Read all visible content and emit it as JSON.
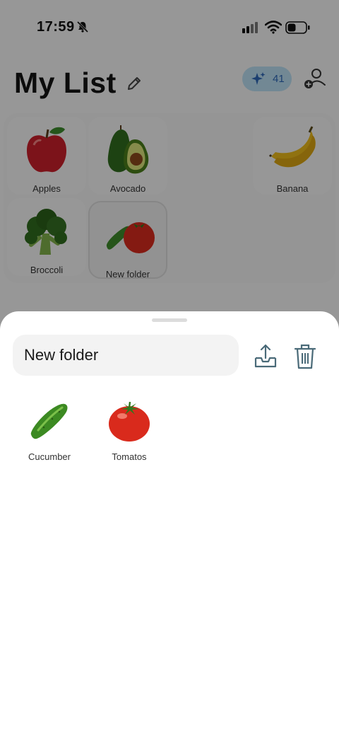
{
  "status_bar": {
    "time": "17:59"
  },
  "header": {
    "title": "My List",
    "credits": "41"
  },
  "grid_items": [
    {
      "label": "Apples",
      "icon": "apple-icon"
    },
    {
      "label": "Avocado",
      "icon": "avocado-icon"
    },
    {
      "label": "Banana",
      "icon": "banana-icon"
    },
    {
      "label": "Broccoli",
      "icon": "broccoli-icon"
    },
    {
      "label": "New folder",
      "icon": "folder-icon"
    }
  ],
  "sheet": {
    "folder_name": "New folder",
    "items": [
      {
        "label": "Cucumber",
        "icon": "cucumber-icon"
      },
      {
        "label": "Tomatos",
        "icon": "tomato-icon"
      }
    ]
  },
  "colors": {
    "accent_badge_bg": "#b9dcef",
    "accent_badge_text": "#2e67b5",
    "sheet_bg": "#ffffff"
  }
}
